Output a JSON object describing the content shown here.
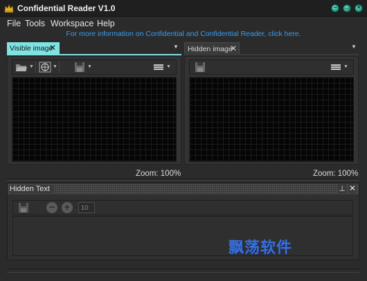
{
  "window": {
    "title": "Confidential Reader V1.0",
    "controls": [
      "minimize",
      "maximize",
      "close"
    ]
  },
  "menu": {
    "items": [
      "File",
      "Tools",
      "Workspace",
      "Help"
    ]
  },
  "info_link": "For more information on Confidential and Confidential Reader, click here.",
  "panels": {
    "visible": {
      "tab_label": "Visible image",
      "close_glyph": "✕",
      "zoom": "Zoom: 100%",
      "toolbar_icons": [
        "open-folder-icon",
        "globe-icon",
        "save-icon",
        "menu-icon"
      ]
    },
    "hidden": {
      "tab_label": "Hidden image",
      "close_glyph": "✕",
      "zoom": "Zoom: 100%",
      "toolbar_icons": [
        "save-icon",
        "menu-icon"
      ]
    }
  },
  "hidden_text": {
    "title": "Hidden Text",
    "pin_glyph": "📌",
    "close_glyph": "✕",
    "font_size_value": "10",
    "toolbar_icons": [
      "save-icon",
      "minus-icon",
      "plus-icon"
    ]
  },
  "watermark": "飘荡软件",
  "colors": {
    "accent_tab": "#7fe3e3",
    "link": "#3c9cf0",
    "window_button": "#2a9d86",
    "background": "#2b2b2b"
  }
}
